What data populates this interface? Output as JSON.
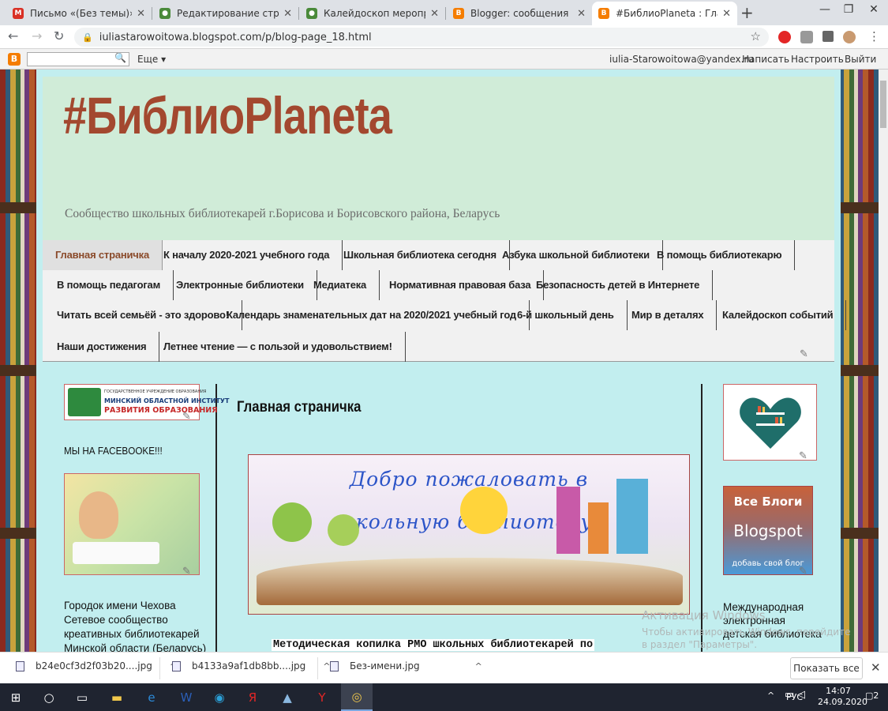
{
  "browser": {
    "tabs": [
      {
        "title": "Письмо «(Без темы)» — Ol",
        "fav_color": "#d93025",
        "fav": "M"
      },
      {
        "title": "Редактирование страницы",
        "fav_color": "#4a8a3a",
        "fav": "●"
      },
      {
        "title": "Калейдоскоп мероприяти",
        "fav_color": "#4a8a3a",
        "fav": "●"
      },
      {
        "title": "Blogger: сообщения",
        "fav_color": "#f57d00",
        "fav": "B"
      },
      {
        "title": "#БиблиоPlaneta : Главная",
        "fav_color": "#f57d00",
        "fav": "B"
      }
    ],
    "new_tab": "+",
    "window_controls": [
      "—",
      "❐",
      "✕"
    ],
    "url": "iuliastarowoitowa.blogspot.com/p/blog-page_18.html"
  },
  "blogger_bar": {
    "logo": "B",
    "search_icon": "🔍",
    "more": "Еще ▾",
    "email": "iulia-Starowoitowa@yandex.ru",
    "write": "Написать",
    "settings": "Настроить",
    "logout": "Выйти"
  },
  "blog": {
    "title": "#БиблиоPlaneta",
    "description": "Сообщество школьных библиотекарей г.Борисова и Борисовского района, Беларусь"
  },
  "menu": {
    "rows": [
      [
        {
          "label": "Главная страничка",
          "selected": true
        },
        {
          "label": "К началу 2020-2021 учебного года"
        },
        {
          "label": "Школьная библиотека сегодня"
        },
        {
          "label": "Азбука школьной библиотеки"
        },
        {
          "label": "В помощь библиотекарю"
        }
      ],
      [
        {
          "label": "В помощь педагогам"
        },
        {
          "label": "Электронные библиотеки"
        },
        {
          "label": "Медиатека"
        },
        {
          "label": "Нормативная правовая база"
        },
        {
          "label": "Безопасность детей в Интернете"
        }
      ],
      [
        {
          "label": "Читать всей семьёй - это здорово!"
        },
        {
          "label": "Календарь знаменательных дат на 2020/2021 учебный год"
        },
        {
          "label": "6-й школьный день"
        },
        {
          "label": "Мир в деталях"
        },
        {
          "label": "Калейдоскоп событий"
        }
      ],
      [
        {
          "label": "Наши достижения"
        },
        {
          "label": "Летнее чтение — с пользой и удовольствием!"
        }
      ]
    ]
  },
  "left": {
    "institute_small": "ГОСУДАРСТВЕННОЕ УЧРЕЖДЕНИЕ ОБРАЗОВАНИЯ",
    "institute_line1": "МИНСКИЙ ОБЛАСТНОЙ ИНСТИТУТ",
    "institute_line2": "РАЗВИТИЯ ОБРАЗОВАНИЯ",
    "facebook_heading": "МЫ НА FACEBOOKE!!!",
    "community_lines": [
      "Городок имени Чехова",
      "Сетевое сообщество",
      "креативных библиотекарей",
      "Минской области (Беларусь)"
    ]
  },
  "main": {
    "page_title": "Главная страничка",
    "banner_line1": "Добро пожаловать в",
    "banner_line2": "школьную библиотеку!",
    "method_text": "Методическая копилка РМО школьных библиотекарей по"
  },
  "right": {
    "blogs_title": "Все Блоги",
    "blogs_brand": "Blogspot",
    "blogs_add": "добавь свой блог",
    "intl_lines": [
      "Международная",
      "электронная",
      "детская библиотека"
    ]
  },
  "watermark": {
    "line1": "Активация Windows",
    "line2": "Чтобы активировать Windows, перейдите в раздел \"Параметры\"."
  },
  "downloads": {
    "items": [
      "b24e0cf3d2f03b20....jpg",
      "b4133a9af1db8bb....jpg",
      "Без-имени.jpg"
    ],
    "show_all": "Показать все"
  },
  "taskbar": {
    "lang": "РУС",
    "time": "14:07",
    "date": "24.09.2020",
    "notif": "2"
  }
}
